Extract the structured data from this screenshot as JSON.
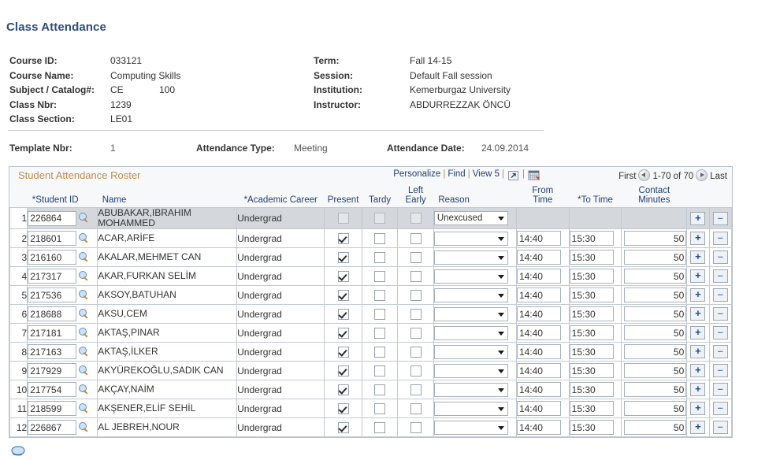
{
  "page": {
    "title": "Class Attendance"
  },
  "course_info": {
    "left": [
      {
        "label": "Course ID:",
        "value": "033121"
      },
      {
        "label": "Course Name:",
        "value": "Computing Skills"
      },
      {
        "label": "Subject / Catalog#:",
        "value": "CE",
        "value2": "100"
      },
      {
        "label": "Class Nbr:",
        "value": "1239"
      },
      {
        "label": "Class Section:",
        "value": "LE01"
      }
    ],
    "right": [
      {
        "label": "Term:",
        "value": "Fall 14-15"
      },
      {
        "label": "Session:",
        "value": "Default Fall session"
      },
      {
        "label": "Institution:",
        "value": "Kemerburgaz University"
      },
      {
        "label": "Instructor:",
        "value": "ABDURREZZAK ÖNCÜ"
      }
    ]
  },
  "template_row": {
    "template_nbr_label": "Template Nbr:",
    "template_nbr_value": "1",
    "attendance_type_label": "Attendance Type:",
    "attendance_type_value": "Meeting",
    "attendance_date_label": "Attendance Date:",
    "attendance_date_value": "24.09.2014"
  },
  "roster": {
    "title": "Student Attendance Roster",
    "toolbar": {
      "personalize": "Personalize",
      "find": "Find",
      "view": "View 5",
      "expand_icon": "expand-icon",
      "download_icon": "download-spreadsheet-icon"
    },
    "pagination": {
      "first": "First",
      "range": "1-70 of 70",
      "last": "Last",
      "prev_icon": "previous-arrow-icon",
      "next_icon": "next-arrow-icon"
    },
    "columns": [
      "*Student ID",
      "Name",
      "*Academic Career",
      "Present",
      "Tardy",
      "Left Early",
      "Reason",
      "From Time",
      "*To Time",
      "Contact Minutes"
    ],
    "column_parts": {
      "left_early_1": "Left",
      "left_early_2": "Early",
      "from_time_1": "From",
      "from_time_2": "Time",
      "contact_1": "Contact",
      "contact_2": "Minutes"
    },
    "row_buttons": {
      "add": "+",
      "remove": "–"
    },
    "rows": [
      {
        "n": "1",
        "id": "226864",
        "name": "ABUBAKAR,IBRAHIM MOHAMMED",
        "career": "Undergrad",
        "present": false,
        "tardy": false,
        "left_early": false,
        "reason": "Unexcused",
        "from_time": "",
        "to_time": "",
        "minutes": ""
      },
      {
        "n": "2",
        "id": "218601",
        "name": "ACAR,ARİFE",
        "career": "Undergrad",
        "present": true,
        "tardy": false,
        "left_early": false,
        "reason": "",
        "from_time": "14:40",
        "to_time": "15:30",
        "minutes": "50"
      },
      {
        "n": "3",
        "id": "216160",
        "name": "AKALAR,MEHMET CAN",
        "career": "Undergrad",
        "present": true,
        "tardy": false,
        "left_early": false,
        "reason": "",
        "from_time": "14:40",
        "to_time": "15:30",
        "minutes": "50"
      },
      {
        "n": "4",
        "id": "217317",
        "name": "AKAR,FURKAN SELİM",
        "career": "Undergrad",
        "present": true,
        "tardy": false,
        "left_early": false,
        "reason": "",
        "from_time": "14:40",
        "to_time": "15:30",
        "minutes": "50"
      },
      {
        "n": "5",
        "id": "217536",
        "name": "AKSOY,BATUHAN",
        "career": "Undergrad",
        "present": true,
        "tardy": false,
        "left_early": false,
        "reason": "",
        "from_time": "14:40",
        "to_time": "15:30",
        "minutes": "50"
      },
      {
        "n": "6",
        "id": "218688",
        "name": "AKSU,CEM",
        "career": "Undergrad",
        "present": true,
        "tardy": false,
        "left_early": false,
        "reason": "",
        "from_time": "14:40",
        "to_time": "15:30",
        "minutes": "50"
      },
      {
        "n": "7",
        "id": "217181",
        "name": "AKTAŞ,PINAR",
        "career": "Undergrad",
        "present": true,
        "tardy": false,
        "left_early": false,
        "reason": "",
        "from_time": "14:40",
        "to_time": "15:30",
        "minutes": "50"
      },
      {
        "n": "8",
        "id": "217163",
        "name": "AKTAŞ,İLKER",
        "career": "Undergrad",
        "present": true,
        "tardy": false,
        "left_early": false,
        "reason": "",
        "from_time": "14:40",
        "to_time": "15:30",
        "minutes": "50"
      },
      {
        "n": "9",
        "id": "217929",
        "name": "AKYÜREKOĞLU,SADIK CAN",
        "career": "Undergrad",
        "present": true,
        "tardy": false,
        "left_early": false,
        "reason": "",
        "from_time": "14:40",
        "to_time": "15:30",
        "minutes": "50"
      },
      {
        "n": "10",
        "id": "217754",
        "name": "AKÇAY,NAİM",
        "career": "Undergrad",
        "present": true,
        "tardy": false,
        "left_early": false,
        "reason": "",
        "from_time": "14:40",
        "to_time": "15:30",
        "minutes": "50"
      },
      {
        "n": "11",
        "id": "218599",
        "name": "AKŞENER,ELİF SEHİL",
        "career": "Undergrad",
        "present": true,
        "tardy": false,
        "left_early": false,
        "reason": "",
        "from_time": "14:40",
        "to_time": "15:30",
        "minutes": "50"
      },
      {
        "n": "12",
        "id": "226867",
        "name": "AL JEBREH,NOUR",
        "career": "Undergrad",
        "present": true,
        "tardy": false,
        "left_early": false,
        "reason": "",
        "from_time": "14:40",
        "to_time": "15:30",
        "minutes": "50"
      }
    ]
  },
  "colors": {
    "title_blue": "#2e4d7b",
    "header_blue": "#1f3f73",
    "roster_title": "#c08d4e",
    "first_row_bg": "#d4d8dd",
    "panel_bg": "#f7f8fa",
    "grid_border": "#c3c9d2"
  }
}
